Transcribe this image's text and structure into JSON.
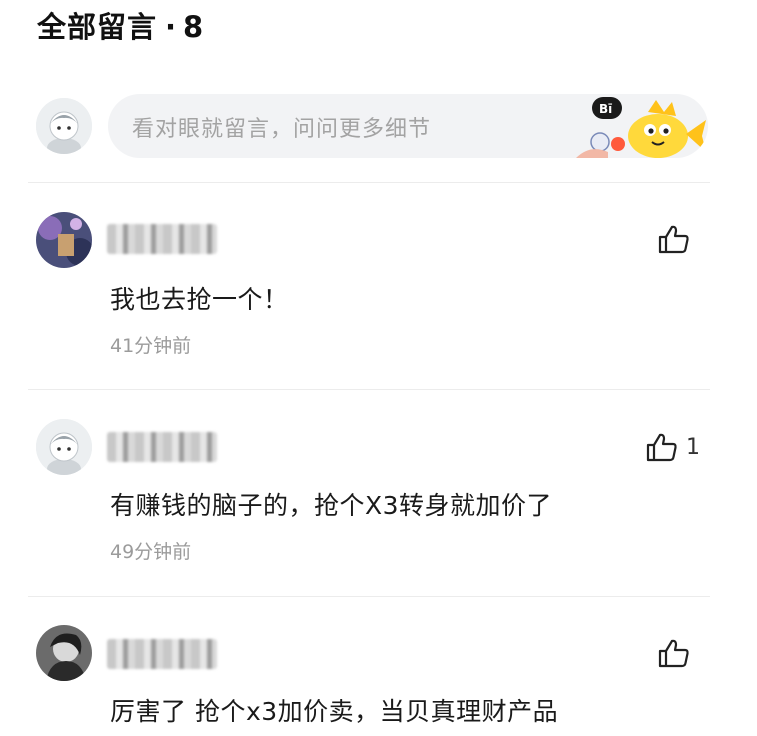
{
  "header": {
    "title": "全部留言",
    "separator": "·",
    "count": "8"
  },
  "input": {
    "placeholder": "看对眼就留言，问问更多细节"
  },
  "icons": {
    "like": "thumbs-up-icon",
    "mascot": "fish-mascot-icon"
  },
  "colors": {
    "input_bg": "#f2f3f5",
    "divider": "#ececec",
    "time": "#9b9b9b",
    "mascot": "#ffd93b"
  },
  "comments": [
    {
      "username": "",
      "text": "我也去抢一个！",
      "time": "41分钟前",
      "likes": ""
    },
    {
      "username": "",
      "text": "有赚钱的脑子的，抢个X3转身就加价了",
      "time": "49分钟前",
      "likes": "1"
    },
    {
      "username": "",
      "text": "厉害了 抢个x3加价卖，当贝真理财产品",
      "time": "",
      "likes": ""
    }
  ]
}
